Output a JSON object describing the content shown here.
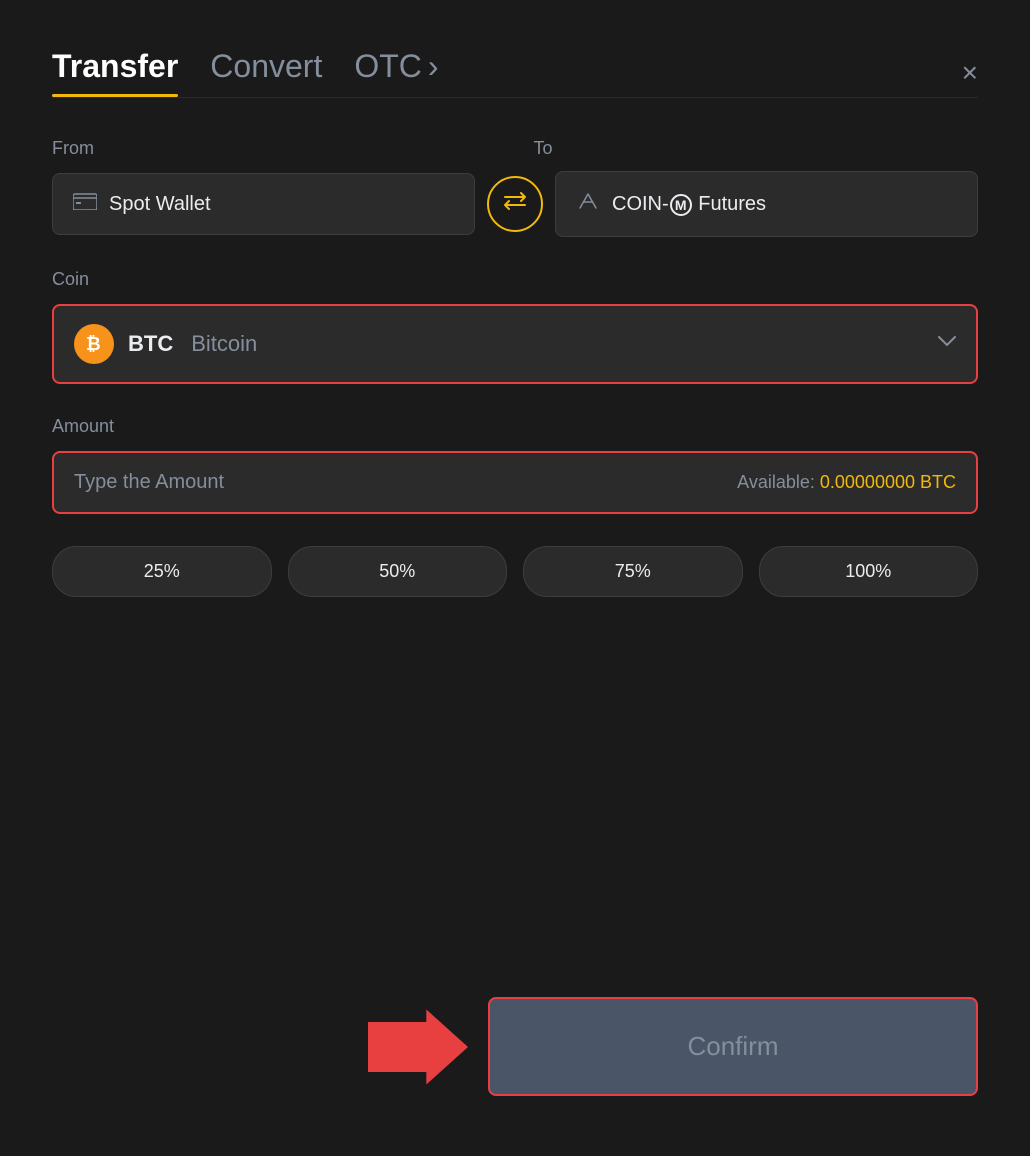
{
  "header": {
    "tab_transfer": "Transfer",
    "tab_convert": "Convert",
    "tab_otc": "OTC",
    "otc_arrow": "›",
    "close_label": "×"
  },
  "from": {
    "label": "From",
    "wallet_icon": "▬",
    "wallet_name": "Spot Wallet"
  },
  "to": {
    "label": "To",
    "wallet_icon": "↑",
    "wallet_name": "COIN-",
    "wallet_m": "M",
    "wallet_suffix": " Futures"
  },
  "swap": {
    "icon": "⇄"
  },
  "coin": {
    "label": "Coin",
    "symbol": "BTC",
    "full_name": "Bitcoin",
    "btc_symbol": "₿"
  },
  "amount": {
    "label": "Amount",
    "placeholder": "Type the Amount",
    "available_label": "Available: ",
    "available_value": "0.00000000 BTC"
  },
  "percentages": [
    {
      "label": "25%"
    },
    {
      "label": "50%"
    },
    {
      "label": "75%"
    },
    {
      "label": "100%"
    }
  ],
  "confirm_button": {
    "label": "Confirm"
  }
}
